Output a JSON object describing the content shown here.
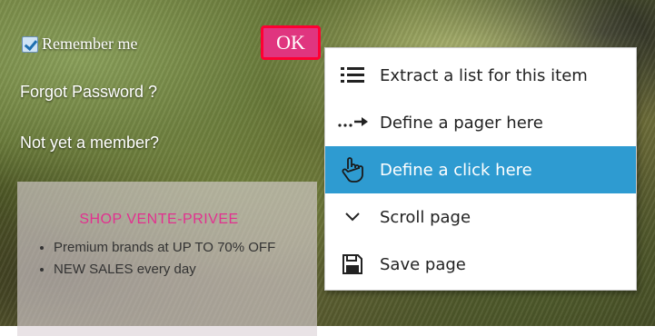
{
  "login": {
    "remember_label": "Remember me",
    "ok_label": "OK",
    "forgot_label": "Forgot Password ?",
    "not_member_label": "Not yet a member?"
  },
  "promo": {
    "title": "SHOP VENTE-PRIVEE",
    "items": [
      "Premium brands at UP TO 70% OFF",
      "NEW SALES every day"
    ]
  },
  "context_menu": {
    "items": [
      {
        "label": "Extract a list for this item",
        "icon": "list-icon"
      },
      {
        "label": "Define a pager here",
        "icon": "pager-arrow-icon"
      },
      {
        "label": "Define a click here",
        "icon": "hand-pointer-icon",
        "highlighted": true
      },
      {
        "label": "Scroll page",
        "icon": "chevron-down-icon"
      },
      {
        "label": "Save page",
        "icon": "save-icon"
      }
    ]
  },
  "colors": {
    "highlight": "#2e9bd1",
    "ok_button": "#e0357f",
    "promo_title": "#e2308f"
  }
}
